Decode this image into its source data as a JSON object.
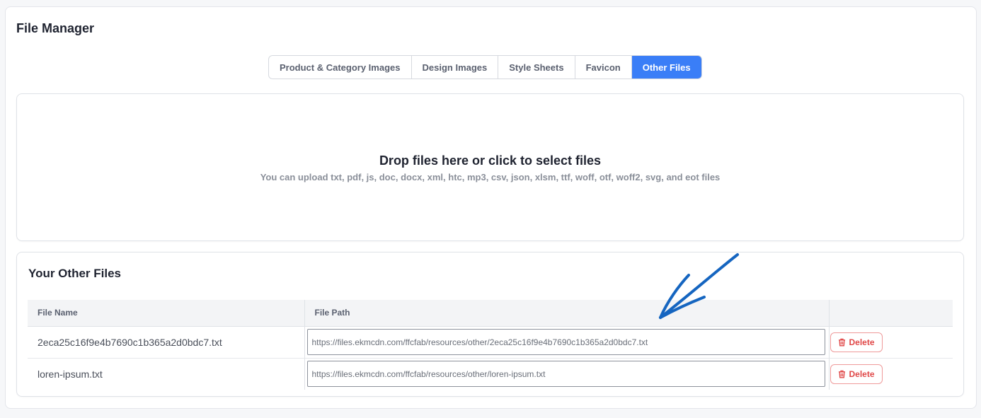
{
  "header": {
    "title": "File Manager"
  },
  "tabs": [
    {
      "label": "Product & Category Images",
      "active": false
    },
    {
      "label": "Design Images",
      "active": false
    },
    {
      "label": "Style Sheets",
      "active": false
    },
    {
      "label": "Favicon",
      "active": false
    },
    {
      "label": "Other Files",
      "active": true
    }
  ],
  "dropzone": {
    "title": "Drop files here or click to select files",
    "hint": "You can upload txt, pdf, js, doc, docx, xml, htc, mp3, csv, json, xlsm, ttf, woff, otf, woff2, svg, and eot files"
  },
  "files": {
    "title": "Your Other Files",
    "columns": {
      "name": "File Name",
      "path": "File Path",
      "action": ""
    },
    "rows": [
      {
        "name": "2eca25c16f9e4b7690c1b365a2d0bdc7.txt",
        "path": "https://files.ekmcdn.com/ffcfab/resources/other/2eca25c16f9e4b7690c1b365a2d0bdc7.txt",
        "delete_label": "Delete"
      },
      {
        "name": "loren-ipsum.txt",
        "path": "https://files.ekmcdn.com/ffcfab/resources/other/loren-ipsum.txt",
        "delete_label": "Delete"
      }
    ]
  },
  "annotation": {
    "icon": "hand-drawn-arrow-icon",
    "color": "#1565c0"
  },
  "colors": {
    "accent": "#3a7ef7",
    "danger": "#e04848",
    "danger_border": "#ef9a9a"
  }
}
